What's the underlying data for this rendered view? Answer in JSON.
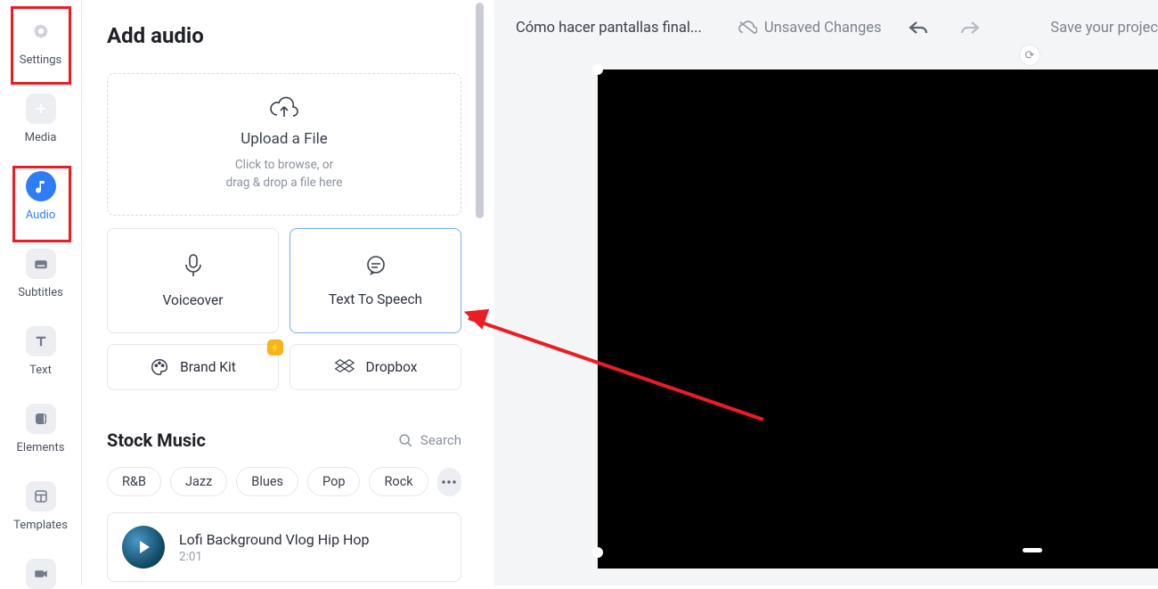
{
  "rail": {
    "settings": "Settings",
    "media": "Media",
    "audio": "Audio",
    "subtitles": "Subtitles",
    "text": "Text",
    "elements": "Elements",
    "templates": "Templates"
  },
  "panel": {
    "heading": "Add audio",
    "upload": {
      "title": "Upload a File",
      "hint1": "Click to browse, or",
      "hint2": "drag & drop a file here"
    },
    "voiceover": "Voiceover",
    "tts": "Text To Speech",
    "brandkit": "Brand Kit",
    "dropbox": "Dropbox",
    "stock_heading": "Stock Music",
    "search_label": "Search",
    "genres": [
      "R&B",
      "Jazz",
      "Blues",
      "Pop",
      "Rock"
    ],
    "track": {
      "title": "Lofi Background Vlog Hip Hop",
      "duration": "2:01"
    }
  },
  "topbar": {
    "project_title": "Cómo hacer pantallas final...",
    "unsaved": "Unsaved Changes",
    "save_prompt": "Save your projec"
  }
}
